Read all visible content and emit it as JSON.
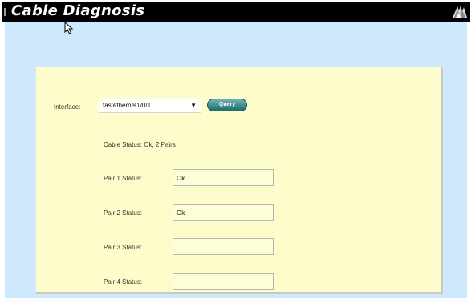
{
  "window": {
    "title": "Cable Diagnosis",
    "logo_icon": "cisco-bridge-logo-icon"
  },
  "form": {
    "interface_label": "Interface:",
    "interface_value": "fastethernet1/0/1",
    "query_label": "Query",
    "cable_status": "Cable Status:  Ok, 2 Pairs"
  },
  "pairs": [
    {
      "label": "Pair 1 Status:",
      "value": "Ok"
    },
    {
      "label": "Pair 2 Status:",
      "value": "Ok"
    },
    {
      "label": "Pair 3 Status:",
      "value": ""
    },
    {
      "label": "Pair 4 Status:",
      "value": ""
    }
  ],
  "colors": {
    "titlebar": "#000000",
    "page_background": "#cde9fb",
    "panel_background": "#fdfdcc",
    "button": "#2c7d7e"
  }
}
